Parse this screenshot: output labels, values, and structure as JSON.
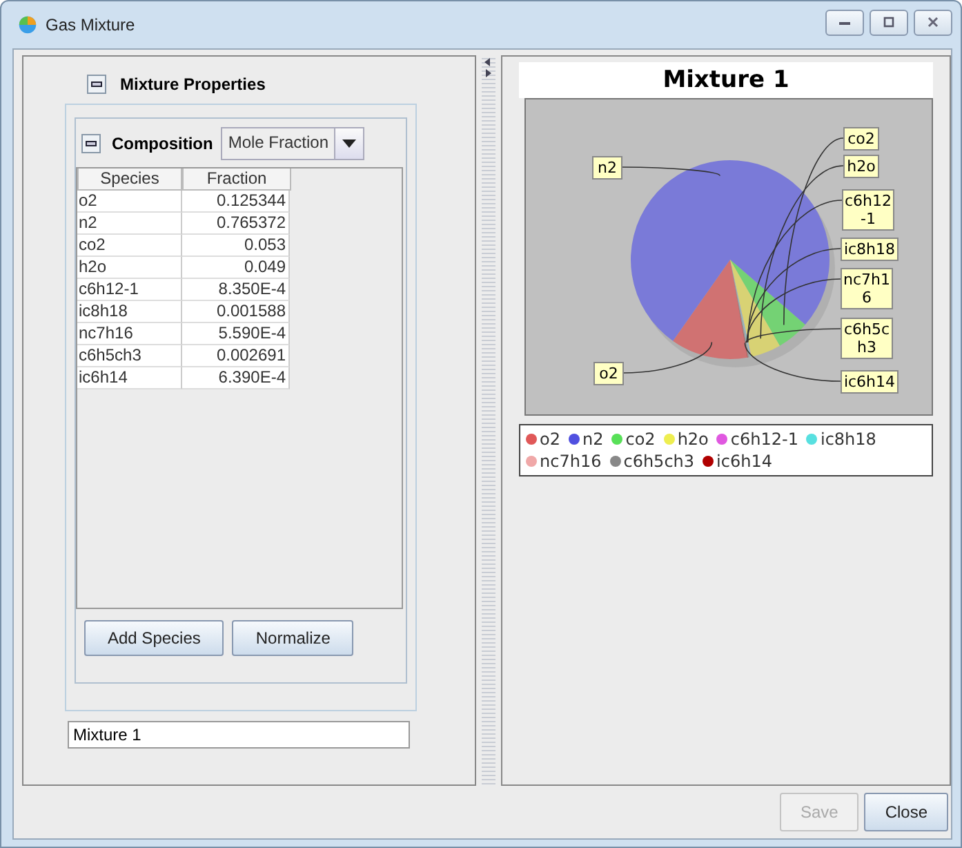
{
  "window": {
    "title": "Gas Mixture"
  },
  "mixture_properties": {
    "title": "Mixture Properties",
    "expanded": true
  },
  "composition": {
    "title": "Composition",
    "expanded": true,
    "basis": "Mole Fraction"
  },
  "table": {
    "columns": [
      "Species",
      "Fraction"
    ],
    "rows": [
      {
        "species": "o2",
        "fraction": "0.125344"
      },
      {
        "species": "n2",
        "fraction": "0.765372"
      },
      {
        "species": "co2",
        "fraction": "0.053"
      },
      {
        "species": "h2o",
        "fraction": "0.049"
      },
      {
        "species": "c6h12-1",
        "fraction": "8.350E-4"
      },
      {
        "species": "ic8h18",
        "fraction": "0.001588"
      },
      {
        "species": "nc7h16",
        "fraction": "5.590E-4"
      },
      {
        "species": "c6h5ch3",
        "fraction": "0.002691"
      },
      {
        "species": "ic6h14",
        "fraction": "6.390E-4"
      }
    ]
  },
  "table_buttons": [
    "Add Species",
    "Normalize"
  ],
  "mixture_name": {
    "value": "Mixture 1"
  },
  "chart": {
    "title": "Mixture 1",
    "slice_labels_left": [
      "n2",
      "o2"
    ],
    "slice_labels_right": [
      "co2",
      "h2o",
      "c6h12-1",
      "ic8h18",
      "nc7h16",
      "c6h5ch3",
      "ic6h14"
    ]
  },
  "legend": [
    {
      "label": "o2",
      "color": "#e05858"
    },
    {
      "label": "n2",
      "color": "#5050e0"
    },
    {
      "label": "co2",
      "color": "#58e058"
    },
    {
      "label": "h2o",
      "color": "#eeee50"
    },
    {
      "label": "c6h12-1",
      "color": "#e058e0"
    },
    {
      "label": "ic8h18",
      "color": "#58e0e0"
    },
    {
      "label": "nc7h16",
      "color": "#f0a8a8"
    },
    {
      "label": "c6h5ch3",
      "color": "#888888"
    },
    {
      "label": "ic6h14",
      "color": "#b00000"
    }
  ],
  "buttons": [
    {
      "label": "Save",
      "disabled": true
    },
    {
      "label": "Close",
      "disabled": false
    }
  ]
}
